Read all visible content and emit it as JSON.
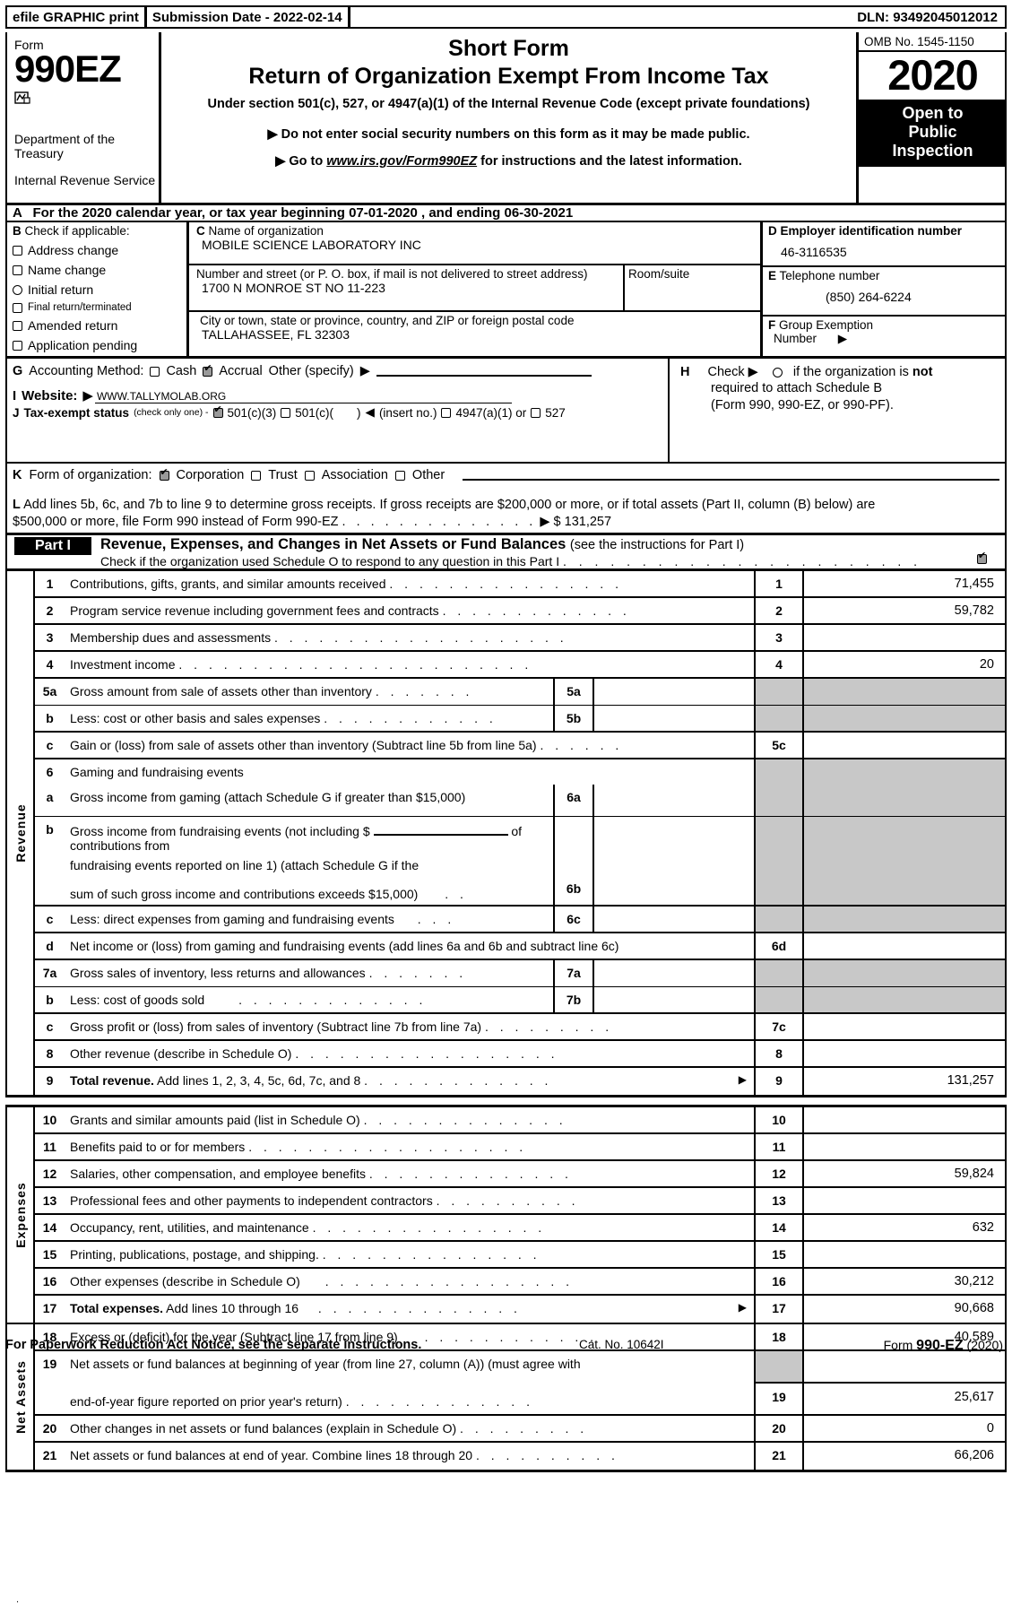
{
  "efile_bar": {
    "left_label": "efile GRAPHIC print",
    "submission_date": "Submission Date - 2022-02-14",
    "dln": "DLN: 93492045012012"
  },
  "masthead": {
    "form_word": "Form",
    "form_number": "990EZ",
    "department": "Department of the Treasury",
    "agency": "Internal Revenue Service",
    "title_small": "Short Form",
    "title_main": "Return of Organization Exempt From Income Tax",
    "subtitle": "Under section 501(c), 527, or 4947(a)(1) of the Internal Revenue Code (except private foundations)",
    "bullet1": "Do not enter social security numbers on this form as it may be made public.",
    "bullet2_pre": "Go to",
    "bullet2_link": "www.irs.gov/Form990EZ",
    "bullet2_post": "for instructions and the latest information.",
    "omb": "OMB No. 1545-1150",
    "year": "2020",
    "open_to": "Open to",
    "public": "Public",
    "inspection": "Inspection"
  },
  "line_a": {
    "letter": "A",
    "text": "For the 2020 calendar year, or tax year beginning 07-01-2020 , and ending 06-30-2021"
  },
  "box_b": {
    "letter": "B",
    "heading": "Check if applicable:",
    "items": [
      {
        "label": "Address change",
        "checked": false,
        "shape": "square"
      },
      {
        "label": "Name change",
        "checked": false,
        "shape": "square"
      },
      {
        "label": "Initial return",
        "checked": false,
        "shape": "round"
      },
      {
        "label": "Final return/terminated",
        "checked": false,
        "shape": "square"
      },
      {
        "label": "Amended return",
        "checked": false,
        "shape": "square"
      },
      {
        "label": "Application pending",
        "checked": false,
        "shape": "square"
      }
    ]
  },
  "box_c": {
    "letter": "C",
    "name_label": "Name of organization",
    "name_value": "MOBILE SCIENCE LABORATORY INC",
    "street_label": "Number and street (or P. O. box, if mail is not delivered to street address)",
    "street_value": "1700 N MONROE ST NO 11-223",
    "room_label": "Room/suite",
    "room_value": "",
    "city_label": "City or town, state or province, country, and ZIP or foreign postal code",
    "city_value": "TALLAHASSEE, FL  32303"
  },
  "box_d": {
    "letter": "D",
    "ein_label": "Employer identification number",
    "ein_value": "46-3116535",
    "letter_e": "E",
    "phone_label": "Telephone number",
    "phone_value": "(850) 264-6224",
    "letter_f": "F",
    "group_label_1": "Group Exemption",
    "group_label_2": "Number"
  },
  "line_g": {
    "letter": "G",
    "label": "Accounting Method:",
    "cash": "Cash",
    "cash_checked": false,
    "accrual": "Accrual",
    "accrual_checked": true,
    "other": "Other (specify)",
    "other_value": ""
  },
  "line_h": {
    "letter": "H",
    "check_word": "Check",
    "text_1": "if the organization is",
    "not_word": "not",
    "text_2": "required to attach Schedule B",
    "text_3": "(Form 990, 990-EZ, or 990-PF).",
    "checked": false
  },
  "line_i": {
    "letter": "I",
    "label": "Website:",
    "value": "WWW.TALLYMOLAB.ORG"
  },
  "line_j": {
    "letter": "J",
    "label": "Tax-exempt status",
    "note": "(check only one) -",
    "opt1": "501(c)(3)",
    "opt1_checked": true,
    "opt2": "501(c)(",
    "opt2_checked": false,
    "opt2_suffix": ")",
    "insert_no": "(insert no.)",
    "opt3": "4947(a)(1) or",
    "opt3_checked": false,
    "opt4": "527",
    "opt4_checked": false
  },
  "line_k": {
    "letter": "K",
    "label": "Form of organization:",
    "options": [
      {
        "label": "Corporation",
        "checked": true
      },
      {
        "label": "Trust",
        "checked": false
      },
      {
        "label": "Association",
        "checked": false
      },
      {
        "label": "Other",
        "checked": false
      }
    ]
  },
  "line_l": {
    "letter": "L",
    "text_1": "Add lines 5b, 6c, and 7b to line 9 to determine gross receipts. If gross receipts are $200,000 or more, or if total assets (Part II, column (B) below) are",
    "text_2": "$500,000 or more, file Form 990 instead of Form 990-EZ",
    "dots": ". . . . . . . . . . . . . .",
    "amount_prefix": "$",
    "amount": "131,257"
  },
  "part_i": {
    "tag": "Part I",
    "title": "Revenue, Expenses, and Changes in Net Assets or Fund Balances",
    "title_note": "(see the instructions for Part I)",
    "sub": "Check if the organization used Schedule O to respond to any question in this Part I",
    "sub_dots": ". . . . . . . . . . . . . . . . . . . . . . .",
    "sub_checked": true
  },
  "sections": {
    "revenue_label": "Revenue",
    "expenses_label": "Expenses",
    "net_assets_label": "Net Assets"
  },
  "revenue_rows": [
    {
      "num": "1",
      "desc": "Contributions, gifts, grants, and similar amounts received",
      "dots": ". . . . . . . . . . . . . . . .",
      "line": "1",
      "amount": "71,455"
    },
    {
      "num": "2",
      "desc": "Program service revenue including government fees and contracts",
      "dots": ". . . . . . . . . . . . .",
      "line": "2",
      "amount": "59,782"
    },
    {
      "num": "3",
      "desc": "Membership dues and assessments",
      "dots": ". . . . . . . . . . . . . . . . . . . .",
      "line": "3",
      "amount": ""
    },
    {
      "num": "4",
      "desc": "Investment income",
      "dots": ". . . . . . . . . . . . . . . . . . . . . . . .",
      "line": "4",
      "amount": "20"
    },
    {
      "num": "5a",
      "desc": "Gross amount from sale of assets other than inventory",
      "dots": ". . . . . . .",
      "sub_line": "5a",
      "sub_amount": ""
    },
    {
      "num": "b",
      "desc": "Less: cost or other basis and sales expenses",
      "dots": ". . . . . . . . . . . .",
      "sub_line": "5b",
      "sub_amount": ""
    },
    {
      "num": "c",
      "desc": "Gain or (loss) from sale of assets other than inventory (Subtract line 5b from line 5a)",
      "dots": ". . . . . .",
      "line": "5c",
      "amount": ""
    },
    {
      "num": "6",
      "desc": "Gaming and fundraising events",
      "dots": "",
      "line": "",
      "amount": ""
    },
    {
      "num": "a",
      "desc": "Gross income from gaming (attach Schedule G if greater than $15,000)",
      "dots": "",
      "sub_line": "6a",
      "sub_amount": ""
    },
    {
      "num": "b",
      "desc_l1a": "Gross income from fundraising events (not including $",
      "desc_l1b": "of contributions from",
      "desc_l2": "fundraising events reported on line 1) (attach Schedule G if the",
      "desc_l3": "sum of such gross income and contributions exceeds $15,000)",
      "dots": ". .",
      "sub_line": "6b",
      "sub_amount": ""
    },
    {
      "num": "c",
      "desc": "Less: direct expenses from gaming and fundraising events",
      "dots": ". . .",
      "sub_line": "6c",
      "sub_amount": ""
    },
    {
      "num": "d",
      "desc": "Net income or (loss) from gaming and fundraising events (add lines 6a and 6b and subtract line 6c)",
      "dots": "",
      "line": "6d",
      "amount": ""
    },
    {
      "num": "7a",
      "desc": "Gross sales of inventory, less returns and allowances",
      "dots": ". . . . . . .",
      "sub_line": "7a",
      "sub_amount": ""
    },
    {
      "num": "b",
      "desc": "Less: cost of goods sold",
      "dots": ". . . . . . . . . . . . .",
      "sub_line": "7b",
      "sub_amount": ""
    },
    {
      "num": "c",
      "desc": "Gross profit or (loss) from sales of inventory (Subtract line 7b from line 7a)",
      "dots": ". . . . . . . . .",
      "line": "7c",
      "amount": ""
    },
    {
      "num": "8",
      "desc": "Other revenue (describe in Schedule O)",
      "dots": ". . . . . . . . . . . . . . . . . .",
      "line": "8",
      "amount": ""
    },
    {
      "num": "9",
      "desc_bold": "Total revenue.",
      "desc": "Add lines 1, 2, 3, 4, 5c, 6d, 7c, and 8",
      "dots": ". . . . . . . . . . . . .",
      "arrow": "▶",
      "line": "9",
      "amount": "131,257"
    }
  ],
  "expense_rows": [
    {
      "num": "10",
      "desc": "Grants and similar amounts paid (list in Schedule O)",
      "dots": ". . . . . . . . . . . . . .",
      "line": "10",
      "amount": ""
    },
    {
      "num": "11",
      "desc": "Benefits paid to or for members",
      "dots": ". . . . . . . . . . . . . . . . . . .",
      "line": "11",
      "amount": ""
    },
    {
      "num": "12",
      "desc": "Salaries, other compensation, and employee benefits",
      "dots": ". . . . . . . . . . . . . .",
      "line": "12",
      "amount": "59,824"
    },
    {
      "num": "13",
      "desc": "Professional fees and other payments to independent contractors",
      "dots": ". . . . . . . . . .",
      "line": "13",
      "amount": ""
    },
    {
      "num": "14",
      "desc": "Occupancy, rent, utilities, and maintenance",
      "dots": ". . . . . . . . . . . . . . . .",
      "line": "14",
      "amount": "632"
    },
    {
      "num": "15",
      "desc": "Printing, publications, postage, and shipping.",
      "dots": ". . . . . . . . . . . . . . .",
      "line": "15",
      "amount": ""
    },
    {
      "num": "16",
      "desc": "Other expenses (describe in Schedule O)",
      "dots": ". . . . . . . . . . . . . . . . .",
      "line": "16",
      "amount": "30,212"
    },
    {
      "num": "17",
      "desc_bold": "Total expenses.",
      "desc": "Add lines 10 through 16",
      "dots": ". . . . . . . . . . . . . .",
      "arrow": "▶",
      "line": "17",
      "amount": "90,668"
    }
  ],
  "net_asset_rows": [
    {
      "num": "18",
      "desc": "Excess or (deficit) for the year (Subtract line 17 from line 9)",
      "dots": ". . . . . . . . . . . .",
      "line": "18",
      "amount": "40,589"
    },
    {
      "num": "19",
      "desc_l1": "Net assets or fund balances at beginning of year (from line 27, column (A)) (must agree with",
      "desc_l2": "end-of-year figure reported on prior year's return)",
      "dots": ". . . . . . . . . . . . .",
      "line": "19",
      "amount": "25,617"
    },
    {
      "num": "20",
      "desc": "Other changes in net assets or fund balances (explain in Schedule O)",
      "dots": ". . . . . . . . .",
      "line": "20",
      "amount": "0"
    },
    {
      "num": "21",
      "desc": "Net assets or fund balances at end of year. Combine lines 18 through 20",
      "dots": ". . . . . . . . . .",
      "line": "21",
      "amount": "66,206"
    }
  ],
  "footer": {
    "notice": "For Paperwork Reduction Act Notice, see the separate instructions.",
    "cat": "Cat. No. 10642I",
    "form_pre": "Form",
    "form_num": "990-EZ",
    "form_year": "(2020)"
  }
}
